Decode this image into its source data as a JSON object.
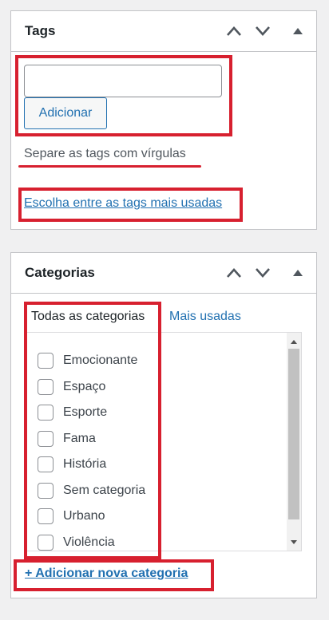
{
  "tags_panel": {
    "title": "Tags",
    "input_value": "",
    "add_button": "Adicionar",
    "hint": "Separe as tags com vírgulas",
    "choose_link": "Escolha entre as tags mais usadas",
    "icons": [
      "chevron-up-icon",
      "chevron-down-icon",
      "triangle-up-icon"
    ]
  },
  "categories_panel": {
    "title": "Categorias",
    "tabs": [
      "Todas as categorias",
      "Mais usadas"
    ],
    "items": [
      {
        "label": "Emocionante",
        "checked": false
      },
      {
        "label": "Espaço",
        "checked": false
      },
      {
        "label": "Esporte",
        "checked": false
      },
      {
        "label": "Fama",
        "checked": false
      },
      {
        "label": "História",
        "checked": false
      },
      {
        "label": "Sem categoria",
        "checked": false
      },
      {
        "label": "Urbano",
        "checked": false
      },
      {
        "label": "Violência",
        "checked": false
      }
    ],
    "add_new_link": "+ Adicionar nova categoria"
  },
  "colors": {
    "link": "#2271b1",
    "annotation_red": "#d7202f"
  }
}
